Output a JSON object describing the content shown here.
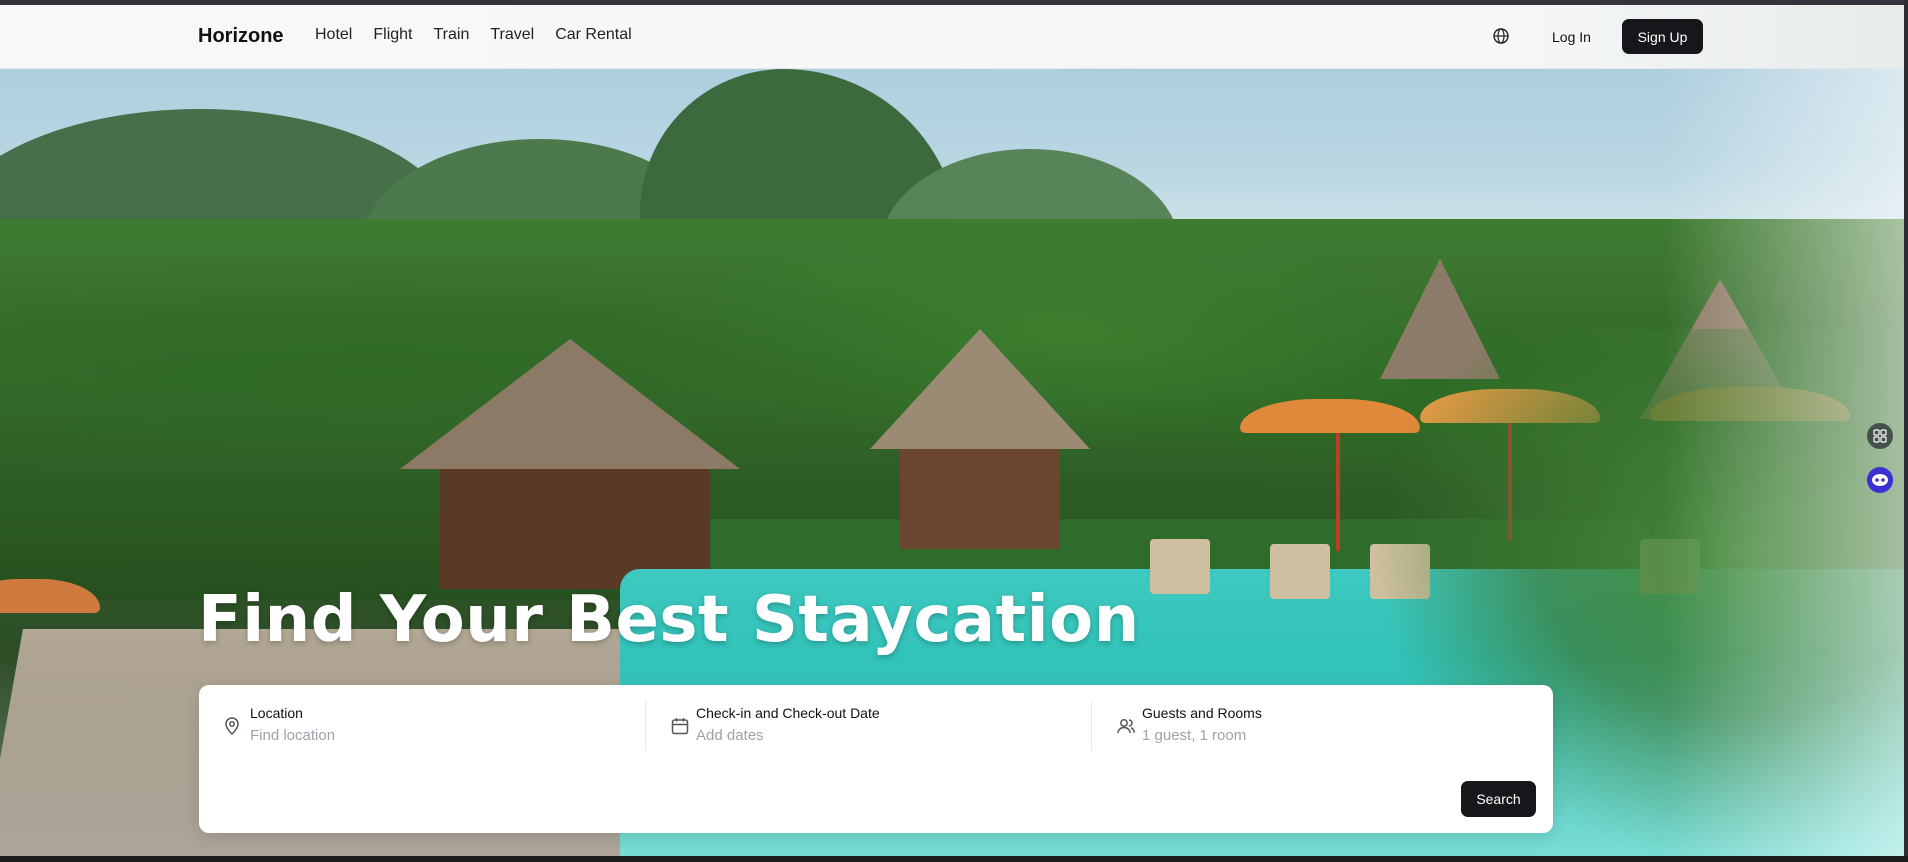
{
  "brand": "Horizone",
  "nav": {
    "links": [
      "Hotel",
      "Flight",
      "Train",
      "Travel",
      "Car Rental"
    ],
    "login_label": "Log In",
    "signup_label": "Sign Up",
    "globe_icon": "globe-icon"
  },
  "hero": {
    "title": "Find Your Best Staycation"
  },
  "search": {
    "location": {
      "label": "Location",
      "placeholder": "Find location",
      "icon": "map-pin-icon"
    },
    "dates": {
      "label": "Check-in and Check-out Date",
      "placeholder": "Add dates",
      "icon": "calendar-icon"
    },
    "guests": {
      "label": "Guests and Rooms",
      "placeholder": "1 guest, 1 room",
      "icon": "users-icon"
    },
    "button_label": "Search"
  },
  "colors": {
    "primary_button": "#16171a",
    "placeholder_text": "#9ca3ab",
    "widget_accent": "#3b2fd1"
  }
}
